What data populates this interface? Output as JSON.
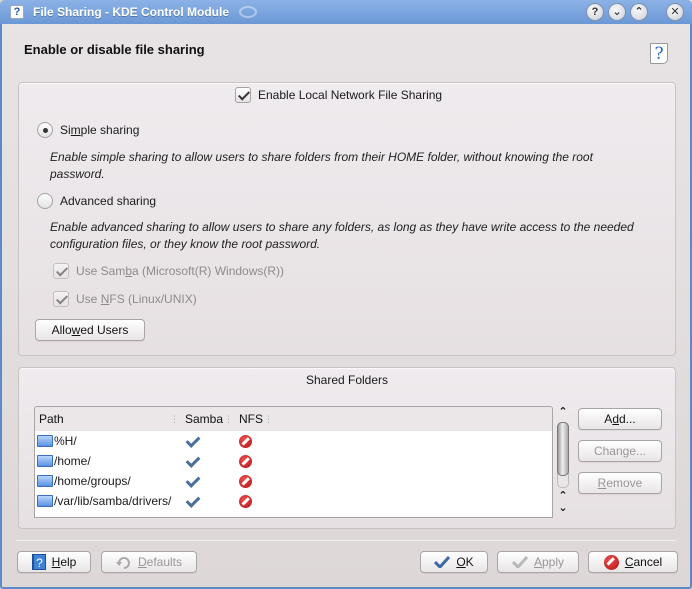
{
  "window": {
    "title": "File Sharing - KDE Control Module",
    "titlebar_buttons": [
      "help",
      "minimize",
      "maximize",
      "close"
    ]
  },
  "header": {
    "title": "Enable or disable file sharing",
    "help_icon": "whats-this-icon"
  },
  "sharing": {
    "enable_checkbox": {
      "label": "Enable Local Network File Sharing",
      "checked": true,
      "mnemonic": "k"
    },
    "simple": {
      "label": "Simple sharing",
      "selected": true,
      "description": "Enable simple sharing to allow users to share folders from their HOME folder, without knowing the root password."
    },
    "advanced": {
      "label": "Advanced sharing",
      "selected": false,
      "description": "Enable advanced sharing to allow users to share any folders, as long as they have write access to the needed configuration files, or they know the root password."
    },
    "use_samba": {
      "label": "Use Samba (Microsoft(R) Windows(R))",
      "checked": true,
      "enabled": false
    },
    "use_nfs": {
      "label": "Use NFS (Linux/UNIX)",
      "checked": true,
      "enabled": false
    },
    "allowed_users_button": "Allowed Users"
  },
  "shared_folders": {
    "title": "Shared Folders",
    "columns": [
      "Path",
      "Samba",
      "NFS"
    ],
    "rows": [
      {
        "path": "%H/",
        "samba": "yes",
        "nfs": "no"
      },
      {
        "path": "/home/",
        "samba": "yes",
        "nfs": "no"
      },
      {
        "path": "/home/groups/",
        "samba": "yes",
        "nfs": "no"
      },
      {
        "path": "/var/lib/samba/drivers/",
        "samba": "yes",
        "nfs": "no"
      }
    ],
    "buttons": {
      "add": "Add...",
      "change": "Change...",
      "remove": "Remove"
    }
  },
  "footer": {
    "help": "Help",
    "defaults": "Defaults",
    "ok": "OK",
    "apply": "Apply",
    "cancel": "Cancel"
  },
  "colors": {
    "titlebar": "#6b98d6",
    "ok_check": "#4a6f9c",
    "cancel_red": "#c01818"
  }
}
